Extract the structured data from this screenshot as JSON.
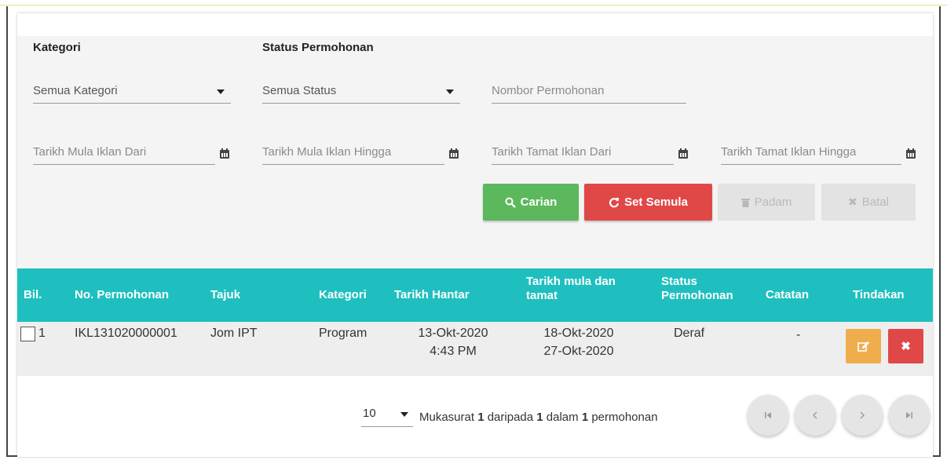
{
  "filters": {
    "kategori_label": "Kategori",
    "status_label": "Status Permohonan",
    "kategori_value": "Semua Kategori",
    "status_value": "Semua Status",
    "nombor_placeholder": "Nombor Permohonan",
    "tarikh_mula_dari": "Tarikh Mula Iklan Dari",
    "tarikh_mula_hingga": "Tarikh Mula Iklan Hingga",
    "tarikh_tamat_dari": "Tarikh Tamat Iklan Dari",
    "tarikh_tamat_hingga": "Tarikh Tamat Iklan Hingga"
  },
  "buttons": {
    "carian": "Carian",
    "set_semula": "Set Semula",
    "padam": "Padam",
    "batal": "Batal"
  },
  "table": {
    "headers": {
      "bil": "Bil.",
      "no_permohonan": "No. Permohonan",
      "tajuk": "Tajuk",
      "kategori": "Kategori",
      "tarikh_hantar": "Tarikh Hantar",
      "tarikh_mula_tamat": "Tarikh mula dan tamat",
      "status": "Status Permohonan",
      "catatan": "Catatan",
      "tindakan": "Tindakan"
    },
    "rows": [
      {
        "bil": "1",
        "no_permohonan": "IKL131020000001",
        "tajuk": "Jom IPT",
        "kategori": "Program",
        "tarikh_hantar_date": "13-Okt-2020",
        "tarikh_hantar_time": "4:43 PM",
        "tarikh_mula": "18-Okt-2020",
        "tarikh_tamat": "27-Okt-2020",
        "status": "Deraf",
        "catatan": "-"
      }
    ]
  },
  "pagination": {
    "page_size": "10",
    "info_prefix": "Mukasurat ",
    "page": "1",
    "info_mid1": " daripada ",
    "total_pages": "1",
    "info_mid2": " dalam ",
    "total_items": "1",
    "info_suffix": " permohonan"
  },
  "colors": {
    "header_bg": "#1fbfbf",
    "search_btn": "#5cb85c",
    "reset_btn": "#e04848",
    "edit_btn": "#f0ad4e",
    "delete_btn": "#e04848"
  },
  "icons": [
    "search-icon",
    "refresh-icon",
    "trash-icon",
    "close-icon",
    "calendar-icon",
    "edit-icon",
    "first-page-icon",
    "prev-page-icon",
    "next-page-icon",
    "last-page-icon"
  ]
}
